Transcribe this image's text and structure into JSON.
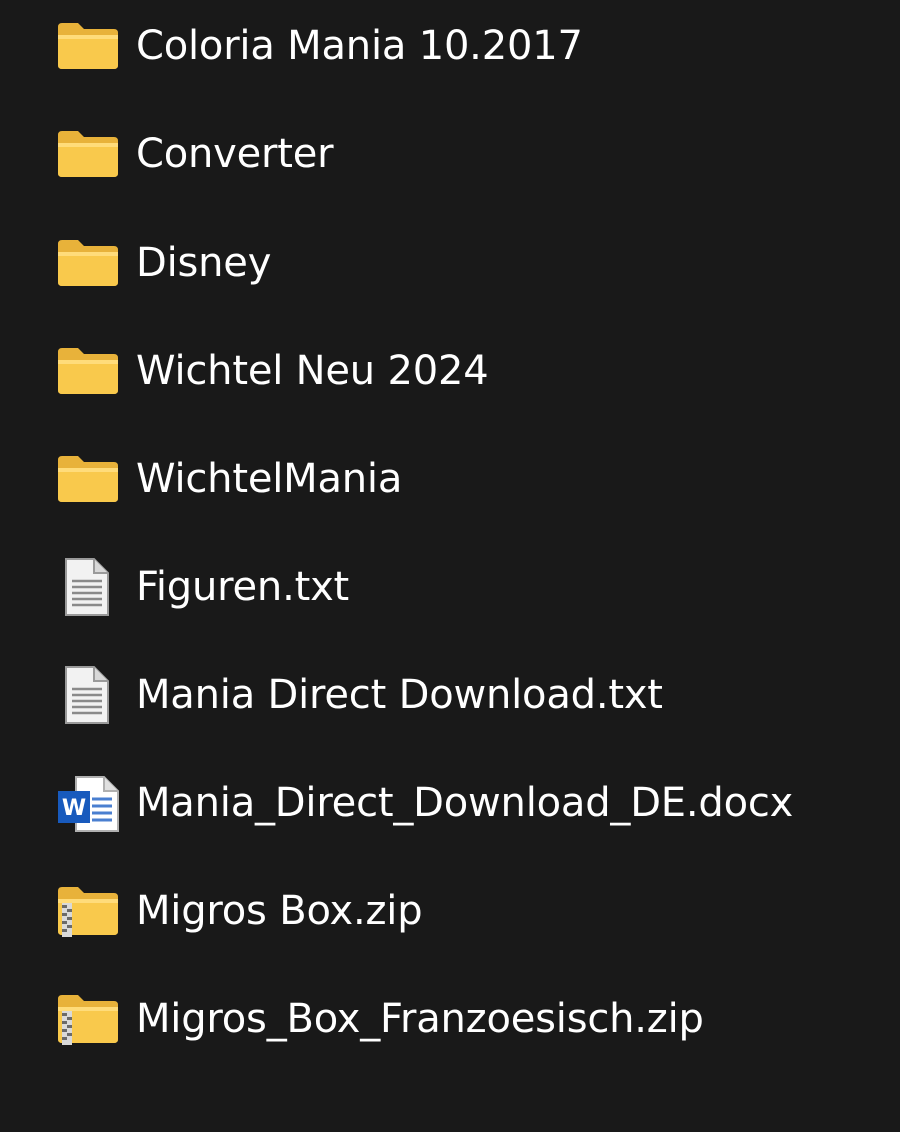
{
  "items": [
    {
      "name": "Coloria Mania 10.2017",
      "icon": "folder-icon"
    },
    {
      "name": "Converter",
      "icon": "folder-icon"
    },
    {
      "name": "Disney",
      "icon": "folder-icon"
    },
    {
      "name": "Wichtel Neu 2024",
      "icon": "folder-icon"
    },
    {
      "name": "WichtelMania",
      "icon": "folder-icon"
    },
    {
      "name": "Figuren.txt",
      "icon": "text-file-icon"
    },
    {
      "name": "Mania Direct Download.txt",
      "icon": "text-file-icon"
    },
    {
      "name": "Mania_Direct_Download_DE.docx",
      "icon": "word-document-icon"
    },
    {
      "name": "Migros Box.zip",
      "icon": "zip-folder-icon"
    },
    {
      "name": "Migros_Box_Franzoesisch.zip",
      "icon": "zip-folder-icon"
    }
  ],
  "colors": {
    "background": "#191919",
    "text": "#ffffff",
    "folder": "#f8c94a",
    "folder_light": "#ffe08a",
    "word_blue": "#185abd"
  }
}
